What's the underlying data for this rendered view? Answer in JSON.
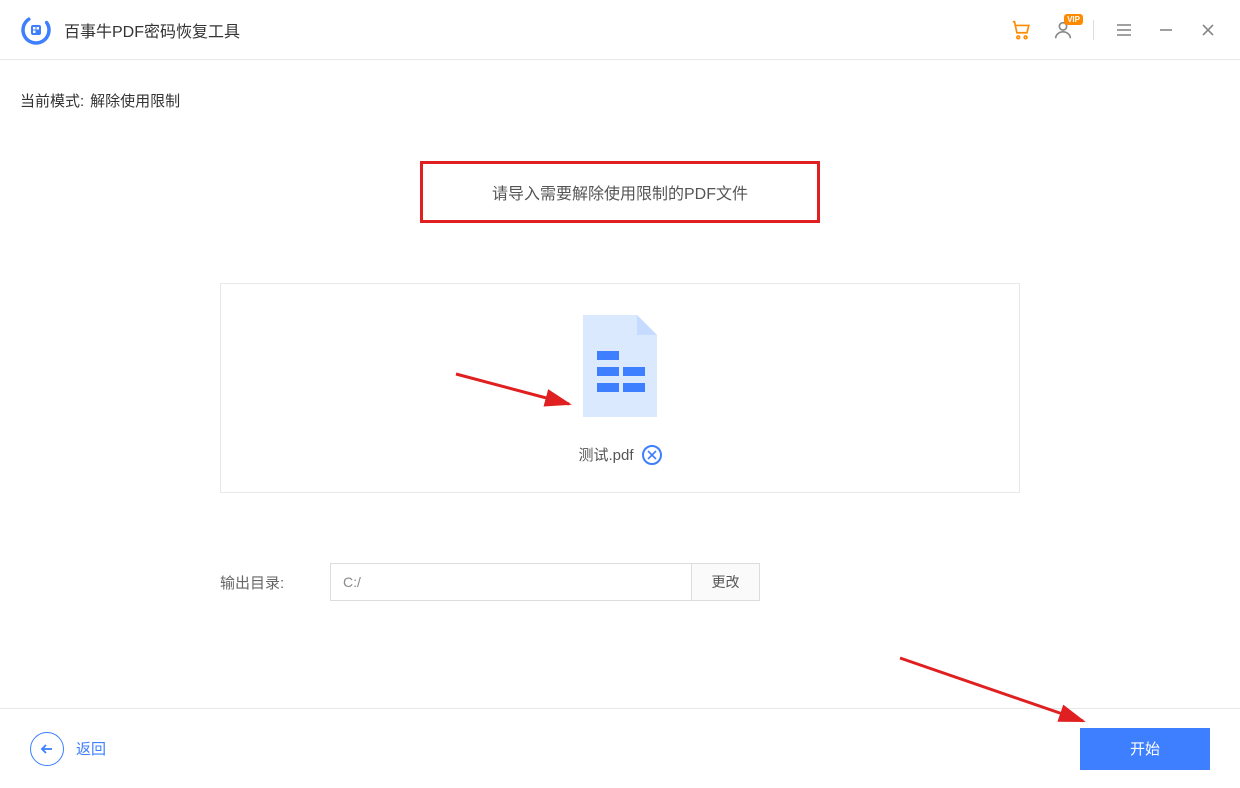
{
  "titlebar": {
    "app_title": "百事牛PDF密码恢复工具",
    "vip_label": "VIP"
  },
  "content": {
    "mode_label": "当前模式:",
    "mode_value": "解除使用限制",
    "instruction": "请导入需要解除使用限制的PDF文件",
    "file_name": "测试.pdf",
    "output_label": "输出目录:",
    "output_path": "C:/",
    "change_btn": "更改"
  },
  "footer": {
    "back_label": "返回",
    "start_label": "开始"
  }
}
